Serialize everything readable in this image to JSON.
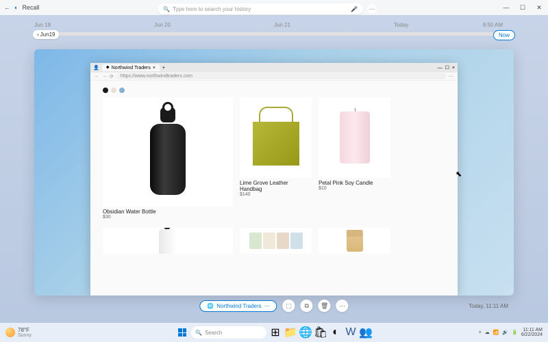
{
  "app": {
    "title": "Recall"
  },
  "window_controls": {
    "min": "—",
    "max": "☐",
    "close": "✕"
  },
  "search": {
    "placeholder": "Type here to search your history",
    "icon": "🔍",
    "mic": "🎤"
  },
  "timeline": {
    "dates": [
      "Jun 19",
      "Jun 20",
      "Jun 21",
      "Today"
    ],
    "time_right": "9:50 AM",
    "prev_label": "Jun19",
    "now_label": "Now"
  },
  "browser": {
    "tab_title": "Northwind Traders",
    "url": "https://www.northwindtraders.com"
  },
  "swatches": [
    "#1a1a1a",
    "#e8e0d0",
    "#88b0d0"
  ],
  "products": {
    "p1": {
      "name": "Obsidian Water Bottle",
      "price": "$30"
    },
    "p2": {
      "name": "Lime Grove Leather Handbag",
      "price": "$140"
    },
    "p3": {
      "name": "Petal Pink Soy Candle",
      "price": "$10"
    }
  },
  "actions": {
    "source": "Northwind Traders",
    "timestamp": "Today, 11:11 AM"
  },
  "taskbar": {
    "weather": {
      "temp": "78°F",
      "cond": "Sunny"
    },
    "search": "Search",
    "clock": {
      "time": "11:11 AM",
      "date": "6/22/2024"
    }
  }
}
